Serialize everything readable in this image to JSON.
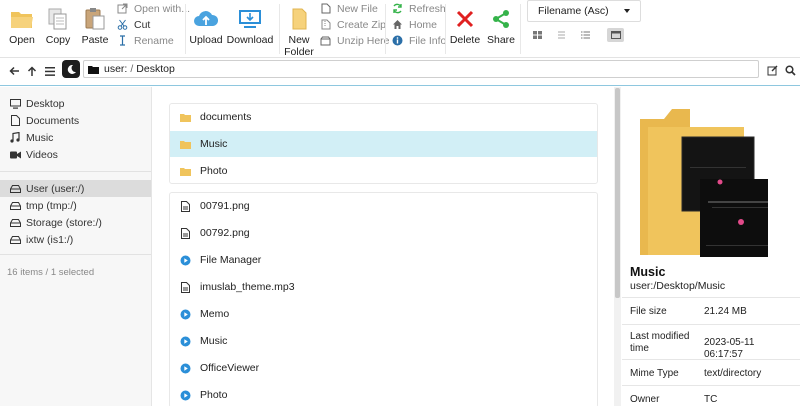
{
  "toolbar": {
    "open": "Open",
    "copy": "Copy",
    "paste": "Paste",
    "open_with": "Open with...",
    "cut": "Cut",
    "rename": "Rename",
    "upload": "Upload",
    "download": "Download",
    "new_folder_line1": "New",
    "new_folder_line2": "Folder",
    "new_file": "New File",
    "create_zip": "Create Zip",
    "unzip_here": "Unzip Here",
    "refresh": "Refresh",
    "home": "Home",
    "file_info": "File Info",
    "delete": "Delete",
    "share": "Share",
    "sort_selected": "Filename (Asc)"
  },
  "addressbar": {
    "root": "user:",
    "separator": "/",
    "folder": "Desktop"
  },
  "sidebar": {
    "places": [
      {
        "label": "Desktop",
        "icon": "desktop-icon"
      },
      {
        "label": "Documents",
        "icon": "document-icon"
      },
      {
        "label": "Music",
        "icon": "music-note-icon"
      },
      {
        "label": "Videos",
        "icon": "video-camera-icon"
      }
    ],
    "drives": [
      {
        "label": "User (user:/)",
        "icon": "drive-icon"
      },
      {
        "label": "tmp (tmp:/)",
        "icon": "drive-icon"
      },
      {
        "label": "Storage (store:/)",
        "icon": "drive-icon"
      },
      {
        "label": "ixtw (is1:/)",
        "icon": "drive-icon"
      }
    ],
    "status": "16 items / 1 selected"
  },
  "folders": [
    {
      "name": "documents",
      "icon": "folder-icon"
    },
    {
      "name": "Music",
      "icon": "folder-icon",
      "selected": true
    },
    {
      "name": "Photo",
      "icon": "folder-icon"
    }
  ],
  "files": [
    {
      "name": "00791.png",
      "icon": "file-icon"
    },
    {
      "name": "00792.png",
      "icon": "file-icon"
    },
    {
      "name": "File Manager",
      "icon": "shortcut-play-icon"
    },
    {
      "name": "imuslab_theme.mp3",
      "icon": "file-icon"
    },
    {
      "name": "Memo",
      "icon": "shortcut-play-icon"
    },
    {
      "name": "Music",
      "icon": "shortcut-play-icon"
    },
    {
      "name": "OfficeViewer",
      "icon": "shortcut-play-icon"
    },
    {
      "name": "Photo",
      "icon": "shortcut-play-icon"
    }
  ],
  "preview": {
    "name": "Music",
    "path": "user:/Desktop/Music",
    "properties": [
      {
        "key": "File size",
        "value": "21.24 MB"
      },
      {
        "key": "Last modified time",
        "value": "2023-05-11 06:17:57"
      },
      {
        "key": "Mime Type",
        "value": "text/directory"
      },
      {
        "key": "Owner",
        "value": "TC"
      }
    ]
  },
  "colors": {
    "accent_blue": "#4aa3df",
    "selected_row": "#d2eff6",
    "folder_yellow": "#f0c45c",
    "delete_red": "#e02020",
    "share_green": "#35b34a",
    "shortcut_blue": "#2b8fd8"
  }
}
